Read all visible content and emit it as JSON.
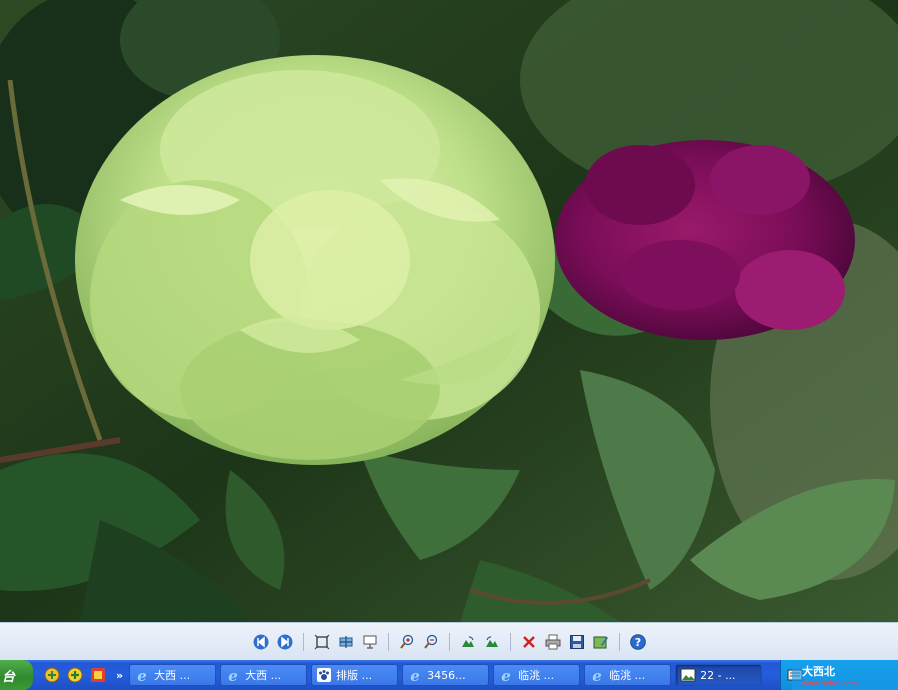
{
  "toolbar": {
    "buttons": [
      {
        "icon": "previous-image-icon"
      },
      {
        "icon": "next-image-icon"
      },
      {
        "icon": "best-fit-icon"
      },
      {
        "icon": "actual-size-icon"
      },
      {
        "icon": "slideshow-icon"
      },
      {
        "icon": "zoom-in-icon"
      },
      {
        "icon": "zoom-out-icon"
      },
      {
        "icon": "rotate-clockwise-icon"
      },
      {
        "icon": "rotate-counterclockwise-icon"
      },
      {
        "icon": "delete-icon"
      },
      {
        "icon": "print-icon"
      },
      {
        "icon": "save-icon"
      },
      {
        "icon": "edit-icon"
      },
      {
        "icon": "help-icon"
      }
    ]
  },
  "taskbar": {
    "start_label": "台",
    "tasks": [
      {
        "label": "大西 ...",
        "icon": "ie-icon",
        "active": false
      },
      {
        "label": "大西 ...",
        "icon": "ie-icon",
        "active": false
      },
      {
        "label": "排版 ...",
        "icon": "paw-icon",
        "active": false
      },
      {
        "label": "3456...",
        "icon": "ie-icon",
        "active": false
      },
      {
        "label": "临洮 ...",
        "icon": "ie-icon",
        "active": false
      },
      {
        "label": "临洮 ...",
        "icon": "ie-icon",
        "active": false
      },
      {
        "label": "22 - ...",
        "icon": "image-viewer-icon",
        "active": true
      }
    ]
  },
  "watermark": {
    "text": "大西北",
    "url": "www.dxbei.com"
  }
}
